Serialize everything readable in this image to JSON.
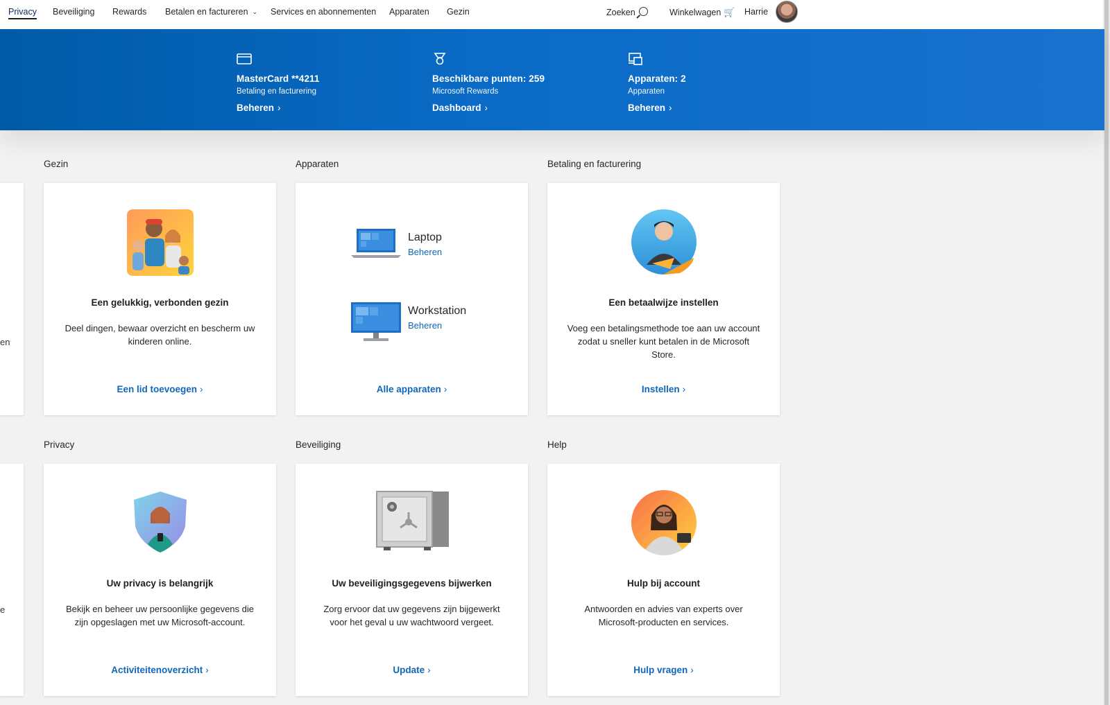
{
  "nav": {
    "items": [
      "Privacy",
      "Beveiliging",
      "Rewards",
      "Betalen en factureren",
      "Services en abonnementen",
      "Apparaten",
      "Gezin"
    ],
    "search": "Zoeken",
    "cart": "Winkelwagen",
    "user": "Harrie"
  },
  "banner": {
    "payment": {
      "title": "MasterCard **4211",
      "sub": "Betaling en facturering",
      "link": "Beheren"
    },
    "rewards": {
      "title": "Beschikbare punten: 259",
      "sub": "Microsoft Rewards",
      "link": "Dashboard"
    },
    "devices": {
      "title": "Apparaten: 2",
      "sub": "Apparaten",
      "link": "Beheren"
    }
  },
  "partial_texts": [
    "en",
    "e"
  ],
  "sections": {
    "gezin": {
      "heading": "Gezin",
      "title": "Een gelukkig, verbonden gezin",
      "desc": "Deel dingen, bewaar overzicht en bescherm uw kinderen online.",
      "link": "Een lid toevoegen"
    },
    "apparaten": {
      "heading": "Apparaten",
      "devices": [
        {
          "name": "Laptop",
          "link": "Beheren"
        },
        {
          "name": "Workstation",
          "link": "Beheren"
        }
      ],
      "link": "Alle apparaten"
    },
    "betaling": {
      "heading": "Betaling en facturering",
      "title": "Een betaalwijze instellen",
      "desc": "Voeg een betalingsmethode toe aan uw account zodat u sneller kunt betalen in de Microsoft Store.",
      "link": "Instellen"
    },
    "privacy": {
      "heading": "Privacy",
      "title": "Uw privacy is belangrijk",
      "desc": "Bekijk en beheer uw persoonlijke gegevens die zijn opgeslagen met uw Microsoft-account.",
      "link": "Activiteitenoverzicht"
    },
    "beveiliging": {
      "heading": "Beveiliging",
      "title": "Uw beveiligingsgegevens bijwerken",
      "desc": "Zorg ervoor dat uw gegevens zijn bijgewerkt voor het geval u uw wachtwoord vergeet.",
      "link": "Update"
    },
    "help": {
      "heading": "Help",
      "title": "Hulp bij account",
      "desc": "Antwoorden en advies van experts over Microsoft-producten en services.",
      "link": "Hulp vragen"
    }
  },
  "colors": {
    "banner": "#0a6bc7",
    "link": "#1066b8",
    "background": "#f2f2f2"
  }
}
